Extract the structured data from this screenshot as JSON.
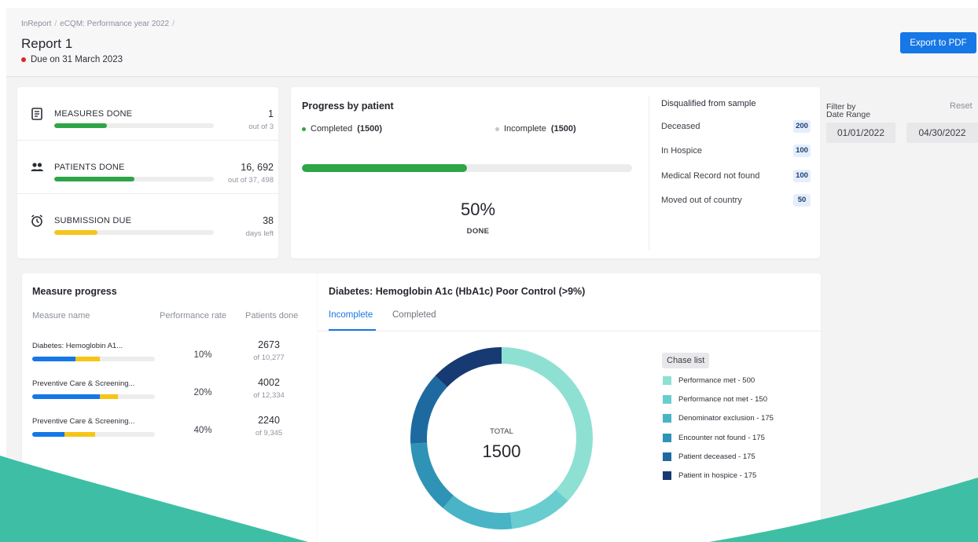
{
  "breadcrumb": [
    "InReport",
    "eCQM: Performance year 2022"
  ],
  "page_title": "Report 1",
  "due_text": "Due on 31 March 2023",
  "export_label": "Export to PDF",
  "stats": [
    {
      "label": "MEASURES DONE",
      "value": "1",
      "sub": "out of 3",
      "fraction": 0.33,
      "color": "#2fa548",
      "icon": "clipboard-icon"
    },
    {
      "label": "PATIENTS DONE",
      "value": "16, 692",
      "sub": "out of 37, 498",
      "fraction": 0.5,
      "color": "#2fa548",
      "icon": "people-icon"
    },
    {
      "label": "SUBMISSION DUE",
      "value": "38",
      "sub": "days left",
      "fraction": 0.27,
      "color": "#f5c518",
      "icon": "alarm-clock-icon"
    }
  ],
  "progress": {
    "title": "Progress by patient",
    "completed_label": "Completed",
    "completed_count": "(1500)",
    "incomplete_label": "Incomplete",
    "incomplete_count": "(1500)",
    "fraction": 0.5,
    "percent": "50%",
    "done_label": "DONE"
  },
  "disqualified": {
    "title": "Disqualified from sample",
    "items": [
      {
        "name": "Deceased",
        "count": "200"
      },
      {
        "name": "In Hospice",
        "count": "100"
      },
      {
        "name": "Medical Record not found",
        "count": "100"
      },
      {
        "name": "Moved out of country",
        "count": "50"
      }
    ]
  },
  "filter": {
    "label_line1": "Filter by",
    "label_line2": "Date Range",
    "reset_label": "Reset",
    "start": "01/01/2022",
    "end": "04/30/2022"
  },
  "measure_progress": {
    "title": "Measure progress",
    "headers": [
      "Measure name",
      "Performance rate",
      "Patients done"
    ],
    "rows": [
      {
        "name": "Diabetes: Hemoglobin A1...",
        "rate": "10%",
        "done": "2673",
        "of": "of 10,277",
        "blue": 0.35,
        "yellow": 0.2
      },
      {
        "name": "Preventive Care & Screening...",
        "rate": "20%",
        "done": "4002",
        "of": "of 12,334",
        "blue": 0.55,
        "yellow": 0.15
      },
      {
        "name": "Preventive Care & Screening...",
        "rate": "40%",
        "done": "2240",
        "of": "of 9,345",
        "blue": 0.26,
        "yellow": 0.25
      }
    ]
  },
  "donut": {
    "title": "Diabetes: Hemoglobin A1c (HbA1c) Poor Control (>9%)",
    "tabs": [
      "Incomplete",
      "Completed"
    ],
    "chase_label": "Chase list",
    "total_label": "TOTAL",
    "total_value": "1500",
    "legend": [
      {
        "label": "Performance met - 500",
        "value": 500,
        "color": "#8ee0d3"
      },
      {
        "label": "Performance not met - 150",
        "value": 150,
        "color": "#69cdd0"
      },
      {
        "label": "Denominator exclusion - 175",
        "value": 175,
        "color": "#49b4c6"
      },
      {
        "label": "Encounter not found - 175",
        "value": 175,
        "color": "#2f93b5"
      },
      {
        "label": "Patient deceased - 175",
        "value": 175,
        "color": "#1e6aa0"
      },
      {
        "label": "Patient in hospice - 175",
        "value": 175,
        "color": "#173a72"
      }
    ]
  },
  "colors": {
    "accent": "#1677e6",
    "green": "#2fa548",
    "yellow": "#f5c518",
    "blue": "#1677e6",
    "due_dot": "#e02424",
    "wave": "#3ebfa5"
  }
}
